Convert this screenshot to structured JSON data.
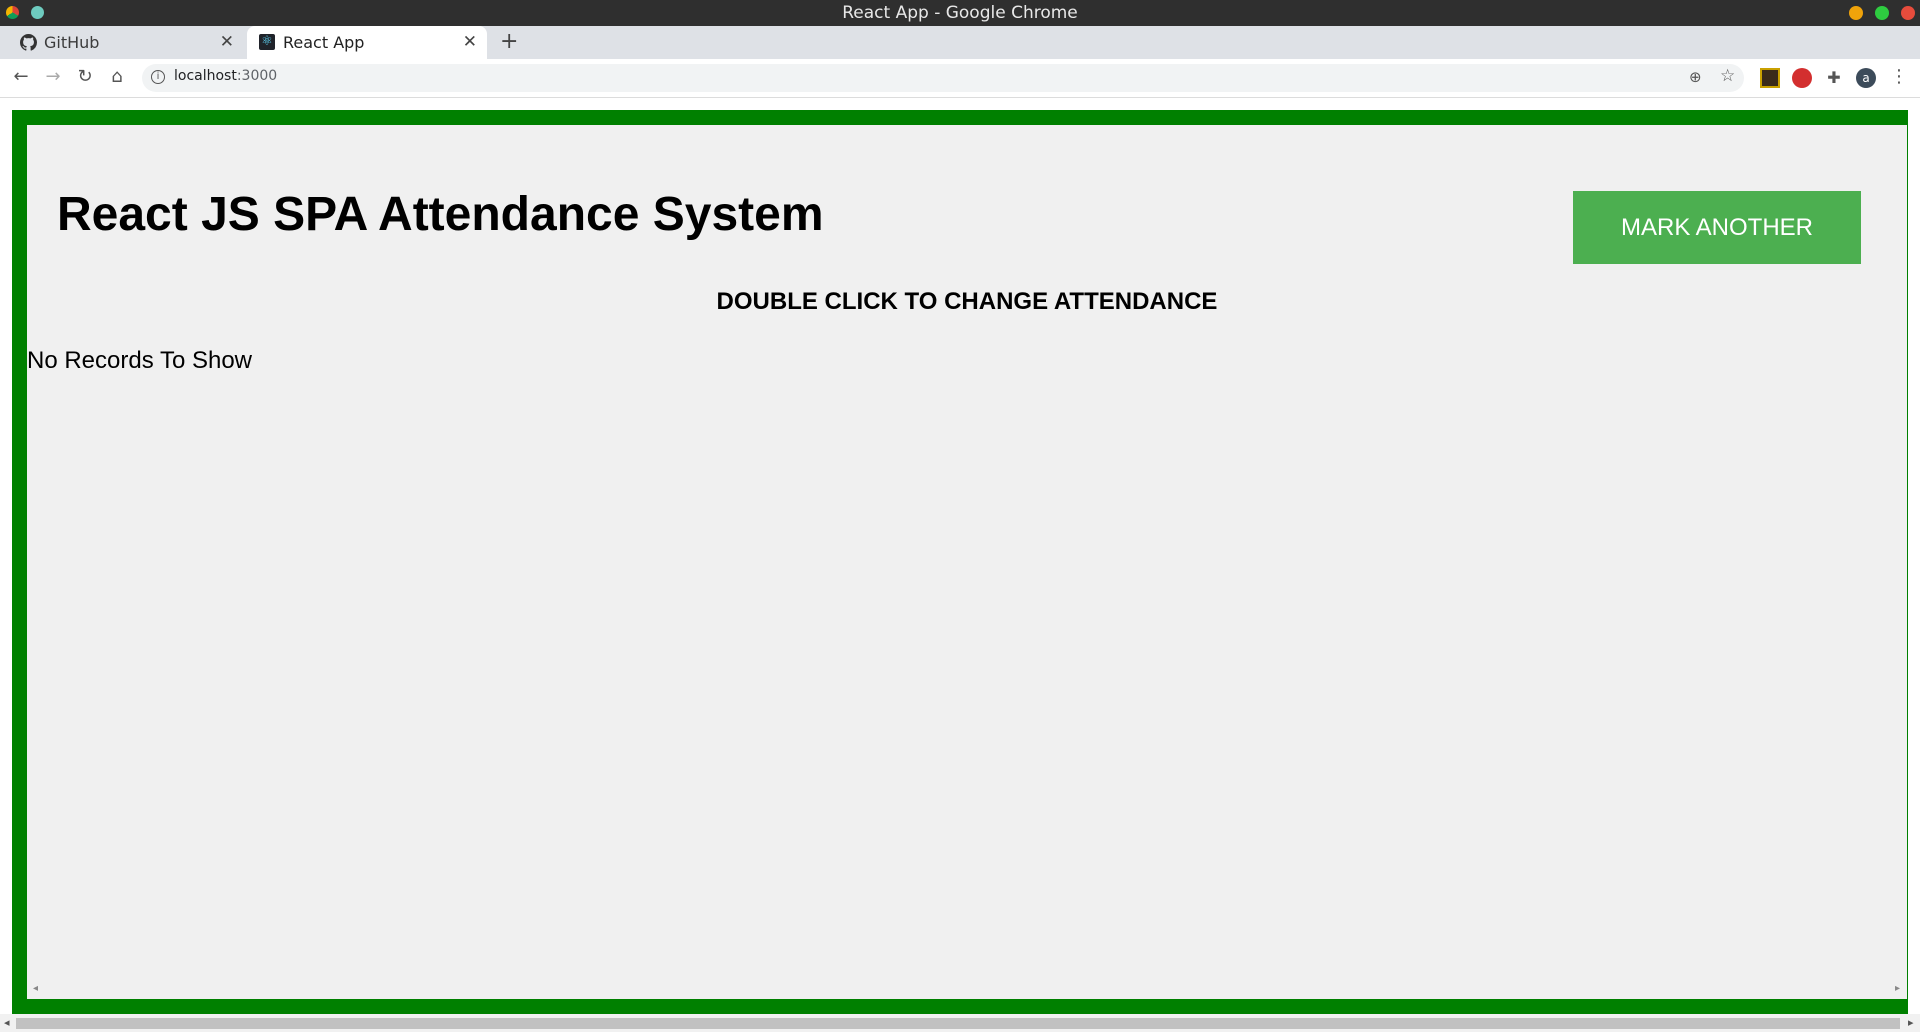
{
  "window": {
    "title": "React App - Google Chrome"
  },
  "tabs": [
    {
      "label": "GitHub",
      "icon": "github-icon",
      "active": false
    },
    {
      "label": "React App",
      "icon": "react-icon",
      "active": true
    }
  ],
  "toolbar": {
    "url_host": "localhost",
    "url_port": ":3000"
  },
  "app": {
    "title": "React JS SPA Attendance System",
    "mark_button_label": "MARK ANOTHER",
    "instruction": "DOUBLE CLICK TO CHANGE ATTENDANCE",
    "empty_message": "No Records To Show"
  },
  "colors": {
    "border_green": "#008000",
    "button_green": "#4caf50",
    "page_bg": "#f0f0f0"
  }
}
